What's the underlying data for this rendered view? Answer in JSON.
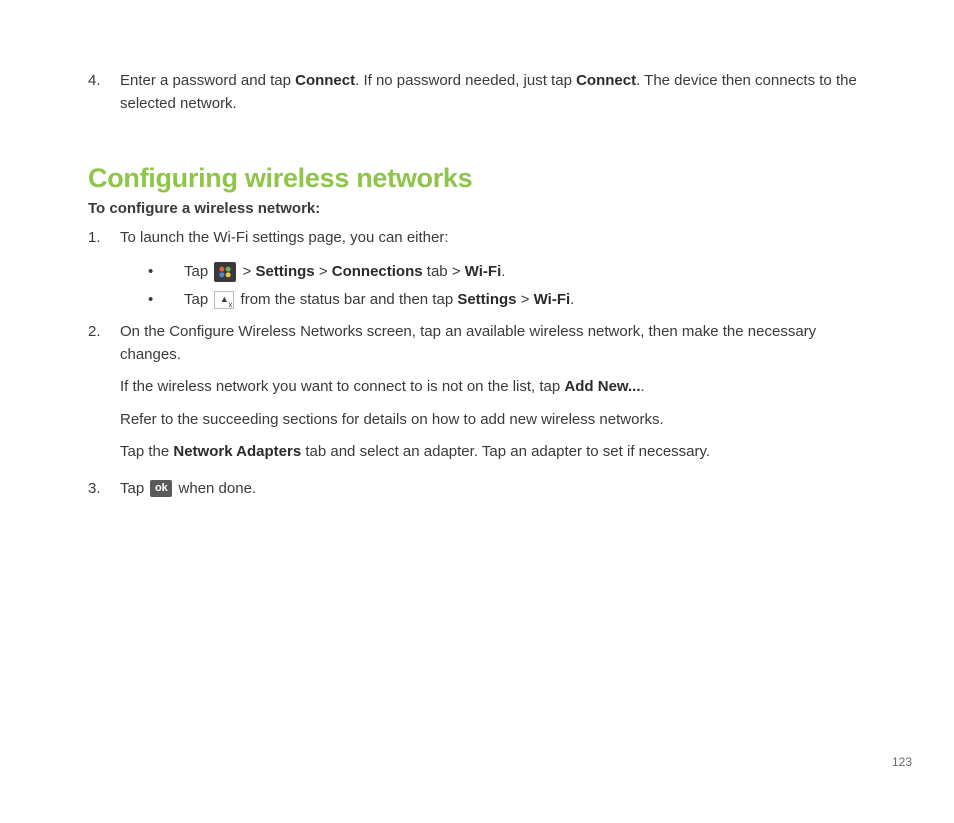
{
  "step4": {
    "marker": "4.",
    "pre": "Enter a password and tap ",
    "b1": "Connect",
    "mid": ". If no password needed, just tap ",
    "b2": "Connect",
    "post": ". The device then connects to the selected network."
  },
  "sectionTitle": "Configuring wireless networks",
  "subheading": "To configure a wireless network:",
  "s1": {
    "marker": "1.",
    "text": "To launch the Wi-Fi settings page, you can either:"
  },
  "bul1": {
    "tap": "Tap ",
    "gt1": " > ",
    "settings": "Settings",
    "gt2": " > ",
    "conn": "Connections",
    "tab": " tab > ",
    "wifi": "Wi-Fi",
    "dot": "."
  },
  "bul2": {
    "tap": "Tap ",
    "from": " from the status bar and then tap ",
    "settings": "Settings",
    "gt": " > ",
    "wifi": "Wi-Fi",
    "dot": "."
  },
  "s2": {
    "marker": "2.",
    "p1a": "On the Configure Wireless Networks screen, tap an available wireless network, then make the necessary changes.",
    "p2a": "If the wireless network you want to connect to is not on the list, tap ",
    "p2b": "Add New...",
    "p2c": ".",
    "p3": "Refer to the succeeding sections for details on how to add new wireless networks.",
    "p4a": "Tap the ",
    "p4b": "Network Adapters",
    "p4c": " tab and select an adapter. Tap an adapter to set if necessary."
  },
  "s3": {
    "marker": "3.",
    "pre": "Tap ",
    "ok": "ok",
    "post": " when done."
  },
  "pageNumber": "123"
}
